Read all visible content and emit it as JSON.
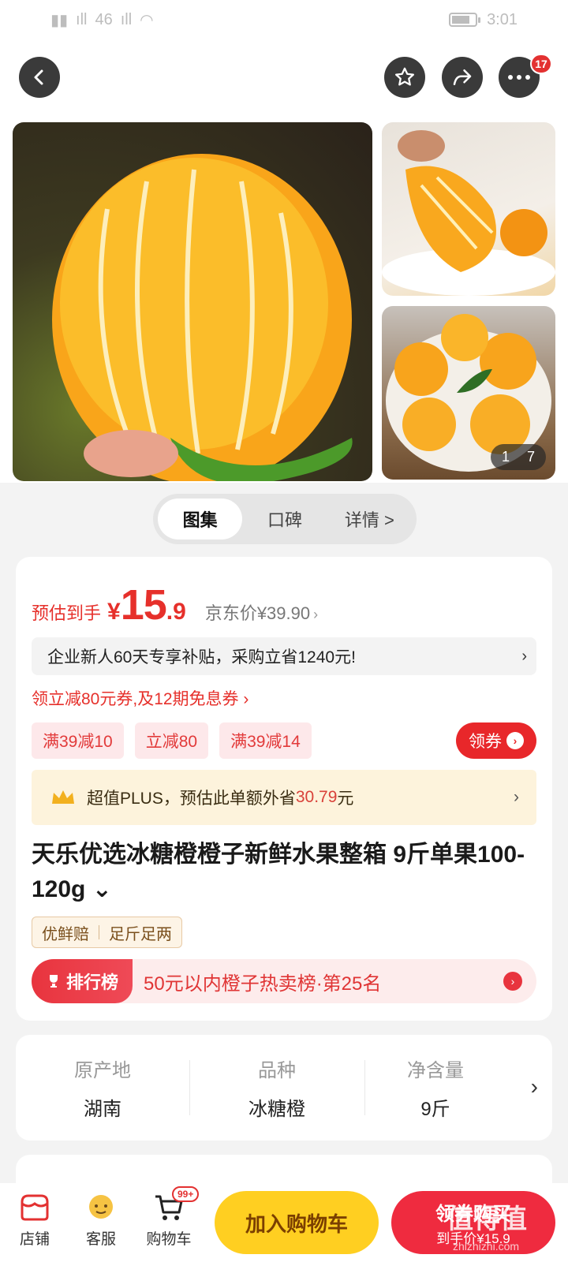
{
  "status_bar": {
    "signal": "46",
    "time": "3:01"
  },
  "header": {
    "more_badge": "17"
  },
  "gallery": {
    "counter_current": "1",
    "counter_total": "7"
  },
  "view_tabs": [
    {
      "label": "图集",
      "active": true
    },
    {
      "label": "口碑",
      "active": false
    },
    {
      "label": "详情 >",
      "active": false
    }
  ],
  "price": {
    "prefix": "预估到手",
    "currency": "¥",
    "integer": "15",
    "decimal": ".9",
    "jd_price": "京东价¥39.90",
    "accent_color": "#e6302b"
  },
  "promo_banner": {
    "text": "企业新人60天专享补贴，采购立省1240元!"
  },
  "coupon_link": {
    "text": "领立减80元券,及12期免息券 ›"
  },
  "tags": [
    "满39减10",
    "立减80",
    "满39减14"
  ],
  "get_coupon": {
    "label": "领券"
  },
  "plus_banner": {
    "text_a": "超值PLUS，预估此单额外省",
    "amount": "30.79",
    "text_b": "元"
  },
  "product": {
    "title": "天乐优选冰糖橙橙子新鲜水果整箱 9斤单果100-120g ⌄"
  },
  "features": [
    "优鲜赔",
    "足斤足两"
  ],
  "ranking": {
    "tag": "排行榜",
    "text": "50元以内橙子热卖榜·第25名"
  },
  "specs": [
    {
      "label": "原产地",
      "value": "湖南"
    },
    {
      "label": "品种",
      "value": "冰糖橙"
    },
    {
      "label": "净含量",
      "value": "9斤"
    }
  ],
  "bottom_bar": {
    "store": "店铺",
    "service": "客服",
    "cart": "购物车",
    "cart_badge": "99+",
    "add_to_cart": "加入购物车",
    "buy_line1": "领券购买",
    "buy_line2": "到手价¥15.9"
  },
  "watermark": {
    "text": "值得值",
    "sub": "zhizhizhi.com"
  }
}
